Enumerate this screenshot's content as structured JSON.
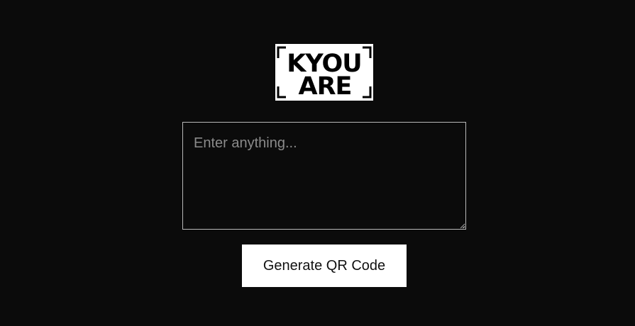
{
  "logo": {
    "line1": "KYOU",
    "line2": "ARE",
    "background_color": "#ffffff",
    "text_color": "#000000"
  },
  "input": {
    "placeholder": "Enter anything...",
    "value": ""
  },
  "generate_button": {
    "label": "Generate QR Code"
  },
  "colors": {
    "page_background": "#0b0b0b",
    "input_border": "#b9b9b9",
    "placeholder_text": "#8b8b8b",
    "button_background": "#ffffff"
  }
}
